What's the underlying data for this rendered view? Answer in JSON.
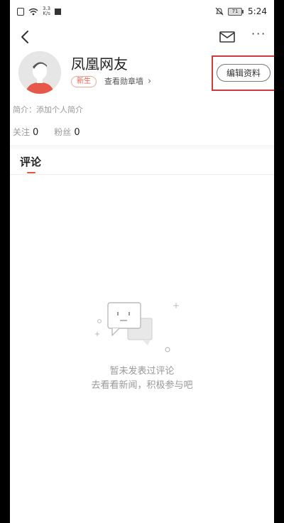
{
  "status_bar": {
    "network_speed_value": "3.3",
    "network_speed_unit": "K/s",
    "battery_level": "71",
    "time": "5:24"
  },
  "profile": {
    "username": "凤凰网友",
    "badge": "新生",
    "medal_wall_link": "查看勋章墙",
    "edit_button": "编辑资料",
    "bio": "简介：添加个人简介",
    "following_label": "关注",
    "following_count": "0",
    "followers_label": "粉丝",
    "followers_count": "0"
  },
  "tabs": {
    "comments": "评论"
  },
  "empty_state": {
    "line1": "暂未发表过评论",
    "line2": "去看看新闻，积极参与吧"
  },
  "icons": {
    "back": "back-arrow-icon",
    "mail": "mail-icon",
    "more": "more-icon"
  },
  "colors": {
    "accent": "#e8523f",
    "highlight_border": "#d23b3b",
    "muted_text": "#999999"
  }
}
